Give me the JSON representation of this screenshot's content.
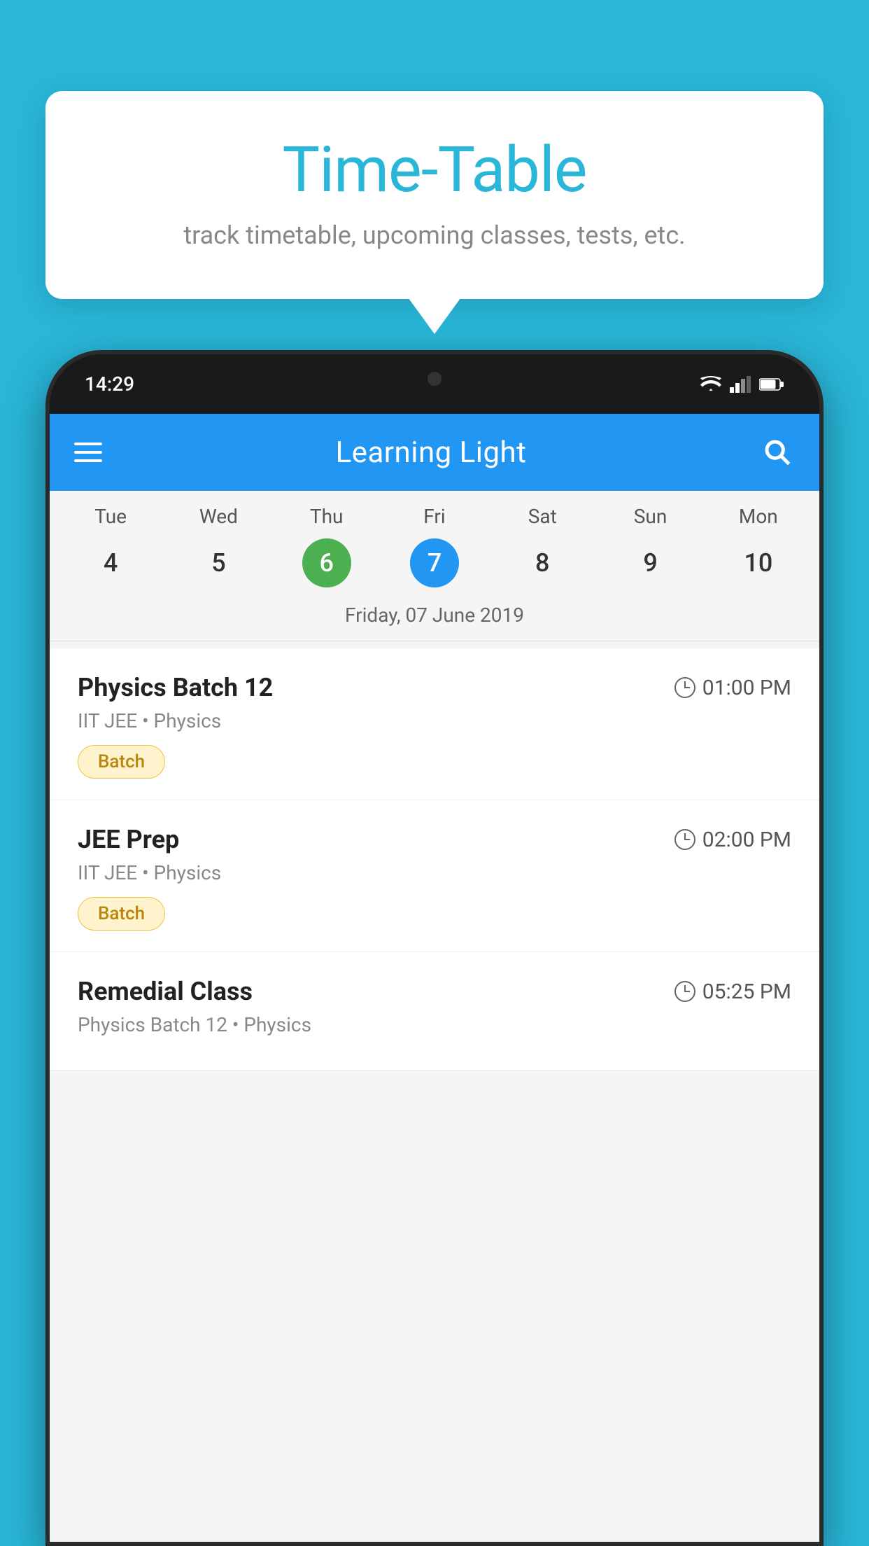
{
  "background": {
    "color": "#29B6D8"
  },
  "tooltip": {
    "title": "Time-Table",
    "subtitle": "track timetable, upcoming classes, tests, etc."
  },
  "phone": {
    "status_bar": {
      "time": "14:29"
    },
    "app_bar": {
      "title": "Learning Light",
      "menu_icon": "hamburger-icon",
      "search_icon": "search-icon"
    },
    "calendar": {
      "days": [
        {
          "name": "Tue",
          "num": "4",
          "state": "normal"
        },
        {
          "name": "Wed",
          "num": "5",
          "state": "normal"
        },
        {
          "name": "Thu",
          "num": "6",
          "state": "today"
        },
        {
          "name": "Fri",
          "num": "7",
          "state": "selected"
        },
        {
          "name": "Sat",
          "num": "8",
          "state": "normal"
        },
        {
          "name": "Sun",
          "num": "9",
          "state": "normal"
        },
        {
          "name": "Mon",
          "num": "10",
          "state": "normal"
        }
      ],
      "selected_date_label": "Friday, 07 June 2019"
    },
    "classes": [
      {
        "name": "Physics Batch 12",
        "time": "01:00 PM",
        "meta": "IIT JEE • Physics",
        "badge": "Batch"
      },
      {
        "name": "JEE Prep",
        "time": "02:00 PM",
        "meta": "IIT JEE • Physics",
        "badge": "Batch"
      },
      {
        "name": "Remedial Class",
        "time": "05:25 PM",
        "meta": "Physics Batch 12 • Physics",
        "badge": ""
      }
    ]
  }
}
